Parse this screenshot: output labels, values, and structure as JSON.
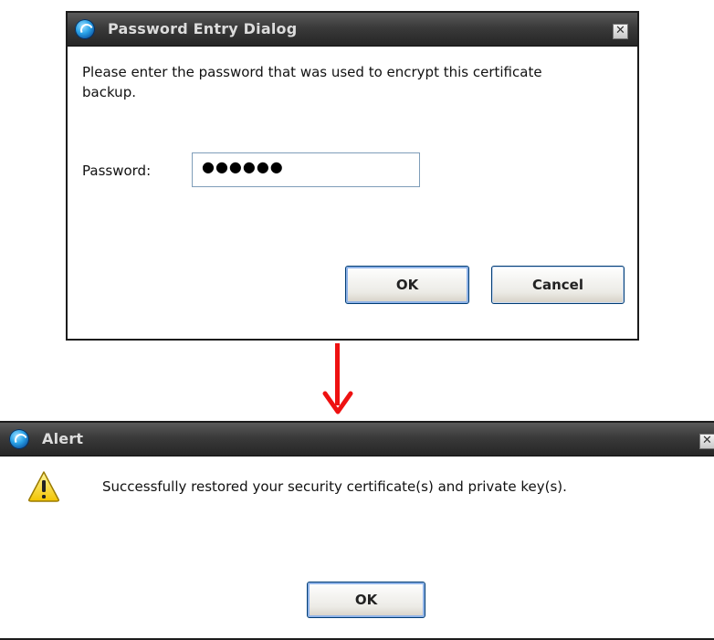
{
  "password_dialog": {
    "title": "Password Entry Dialog",
    "close_glyph": "✕",
    "message": "Please enter the password that was used to encrypt this certificate backup.",
    "password_label": "Password:",
    "password_value": "●●●●●●",
    "ok_label": "OK",
    "cancel_label": "Cancel"
  },
  "alert_dialog": {
    "title": "Alert",
    "close_glyph": "✕",
    "message": "Successfully restored your security certificate(s) and private key(s).",
    "icon": "warning-icon",
    "ok_label": "OK"
  },
  "connector": {
    "icon": "arrow-down-icon",
    "color": "#ee1111"
  }
}
